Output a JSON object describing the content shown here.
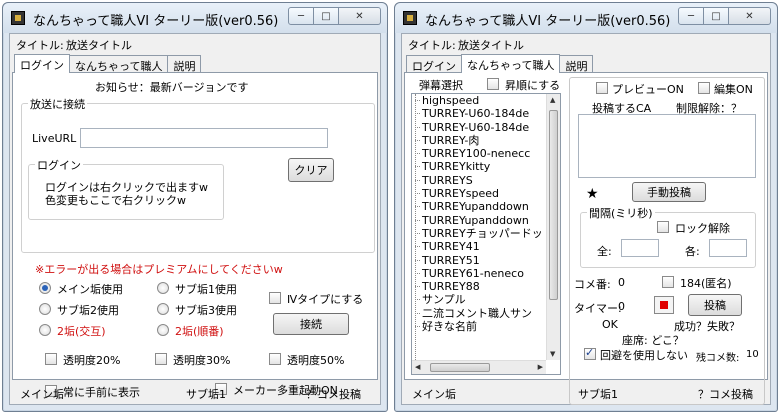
{
  "window1": {
    "title": "なんちゃって職人VI ターリー版(ver0.56)",
    "title_label": "タイトル:",
    "title_value": "放送タイトル",
    "tabs": [
      "ログイン",
      "なんちゃって職人",
      "説明"
    ],
    "notice": "お知らせ：最新バージョンです",
    "broadcast_group": "放送に接続",
    "liveurl_label": "LiveURL",
    "liveurl_value": "",
    "login_group": "ログイン",
    "login_line1": "ログインは右クリックで出ますw",
    "login_line2": "色変更もここで右クリックw",
    "clear_button": "クリア",
    "error_notice": "※エラーが出る場合はプレミアムにしてくださいw",
    "radios": {
      "main": "メイン垢使用",
      "sub1": "サブ垢1使用",
      "sub2": "サブ垢2使用",
      "sub3": "サブ垢3使用",
      "two_alt": "2垢(交互)",
      "two_seq": "2垢(順番)"
    },
    "iv_type": "Ⅳタイプにする",
    "connect_button": "接続",
    "opacity20": "透明度20%",
    "opacity30": "透明度30%",
    "opacity50": "透明度50%",
    "always_front": "常に手前に表示",
    "maker_multi": "メーカー多重起動ON",
    "status": {
      "main": "メイン垢",
      "sub": "サブ垢1",
      "comment": "？コメ投稿"
    }
  },
  "window2": {
    "title": "なんちゃって職人VI ターリー版(ver0.56)",
    "title_label": "タイトル:",
    "title_value": "放送タイトル",
    "tabs": [
      "ログイン",
      "なんちゃって職人",
      "説明"
    ],
    "bullet_select": "弾幕選択",
    "ascending": "昇順にする",
    "list_items": [
      "highspeed",
      "TURREY-U60-184de",
      "TURREY-U60-184de",
      "TURREY-肉",
      "TURREY100-nenecc",
      "TURREYkitty",
      "TURREYS",
      "TURREYspeed",
      "TURREYupanddown",
      "TURREYupanddown",
      "TURREYチョッパードッ",
      "TURREY41",
      "TURREY51",
      "TURREY61-neneco",
      "TURREY88",
      "サンプル",
      "二流コメント職人サン",
      "好きな名前"
    ],
    "preview": "プレビューON",
    "edit": "編集ON",
    "post_ca": "投稿するCA",
    "limit_release": "制限解除：？",
    "star": "★",
    "manual_post": "手動投稿",
    "interval_group": "間隔(ミリ秒)",
    "lock_release": "ロック解除",
    "all_label": "全:",
    "each_label": "各:",
    "comment_no_label": "コメ番:",
    "comment_no_value": "0",
    "anon184": "184(匿名)",
    "timer_label": "タイマー:",
    "timer_value": "0",
    "post_button": "投稿",
    "ok_text": "OK",
    "success_fail": "成功？失敗？",
    "seat_label": "座席: どこ？",
    "avoid": "回避を使用しない",
    "remaining_label": "残コメ数:",
    "remaining_value": "10",
    "status": {
      "main": "メイン垢",
      "sub": "サブ垢1",
      "comment": "？コメ投稿"
    }
  }
}
